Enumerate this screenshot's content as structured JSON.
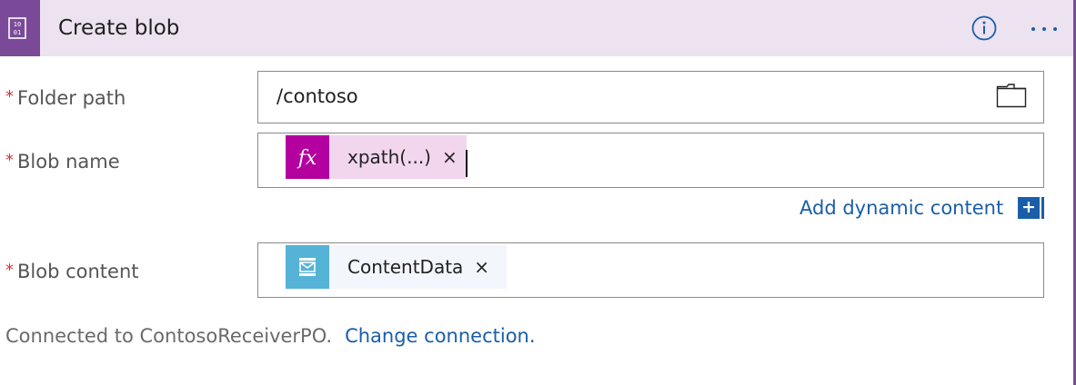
{
  "header": {
    "title": "Create blob",
    "icon": "storage-blob-icon",
    "accent_color": "#7a4a98",
    "background_color": "#ece2f0"
  },
  "fields": {
    "folder_path": {
      "required_marker": "*",
      "label": "Folder path",
      "value": "/contoso"
    },
    "blob_name": {
      "required_marker": "*",
      "label": "Blob name",
      "token_label": "xpath(...)",
      "token_icon": "fx-expression-icon",
      "token_icon_glyph": "fx",
      "token_remove": "×"
    },
    "blob_content": {
      "required_marker": "*",
      "label": "Blob content",
      "token_label": "ContentData",
      "token_icon": "message-content-icon",
      "token_remove": "×"
    }
  },
  "add_dynamic_content": {
    "label": "Add dynamic content",
    "button_glyph": "+"
  },
  "footer": {
    "connected_text": "Connected to ContosoReceiverPO.",
    "change_link": "Change connection."
  },
  "colors": {
    "link": "#1a5ea8",
    "fx_token": "#b4009e",
    "fx_token_bg": "#f2d6ee",
    "content_token": "#54b3d6",
    "content_token_bg": "#f3f6fc",
    "required": "#d13438"
  }
}
